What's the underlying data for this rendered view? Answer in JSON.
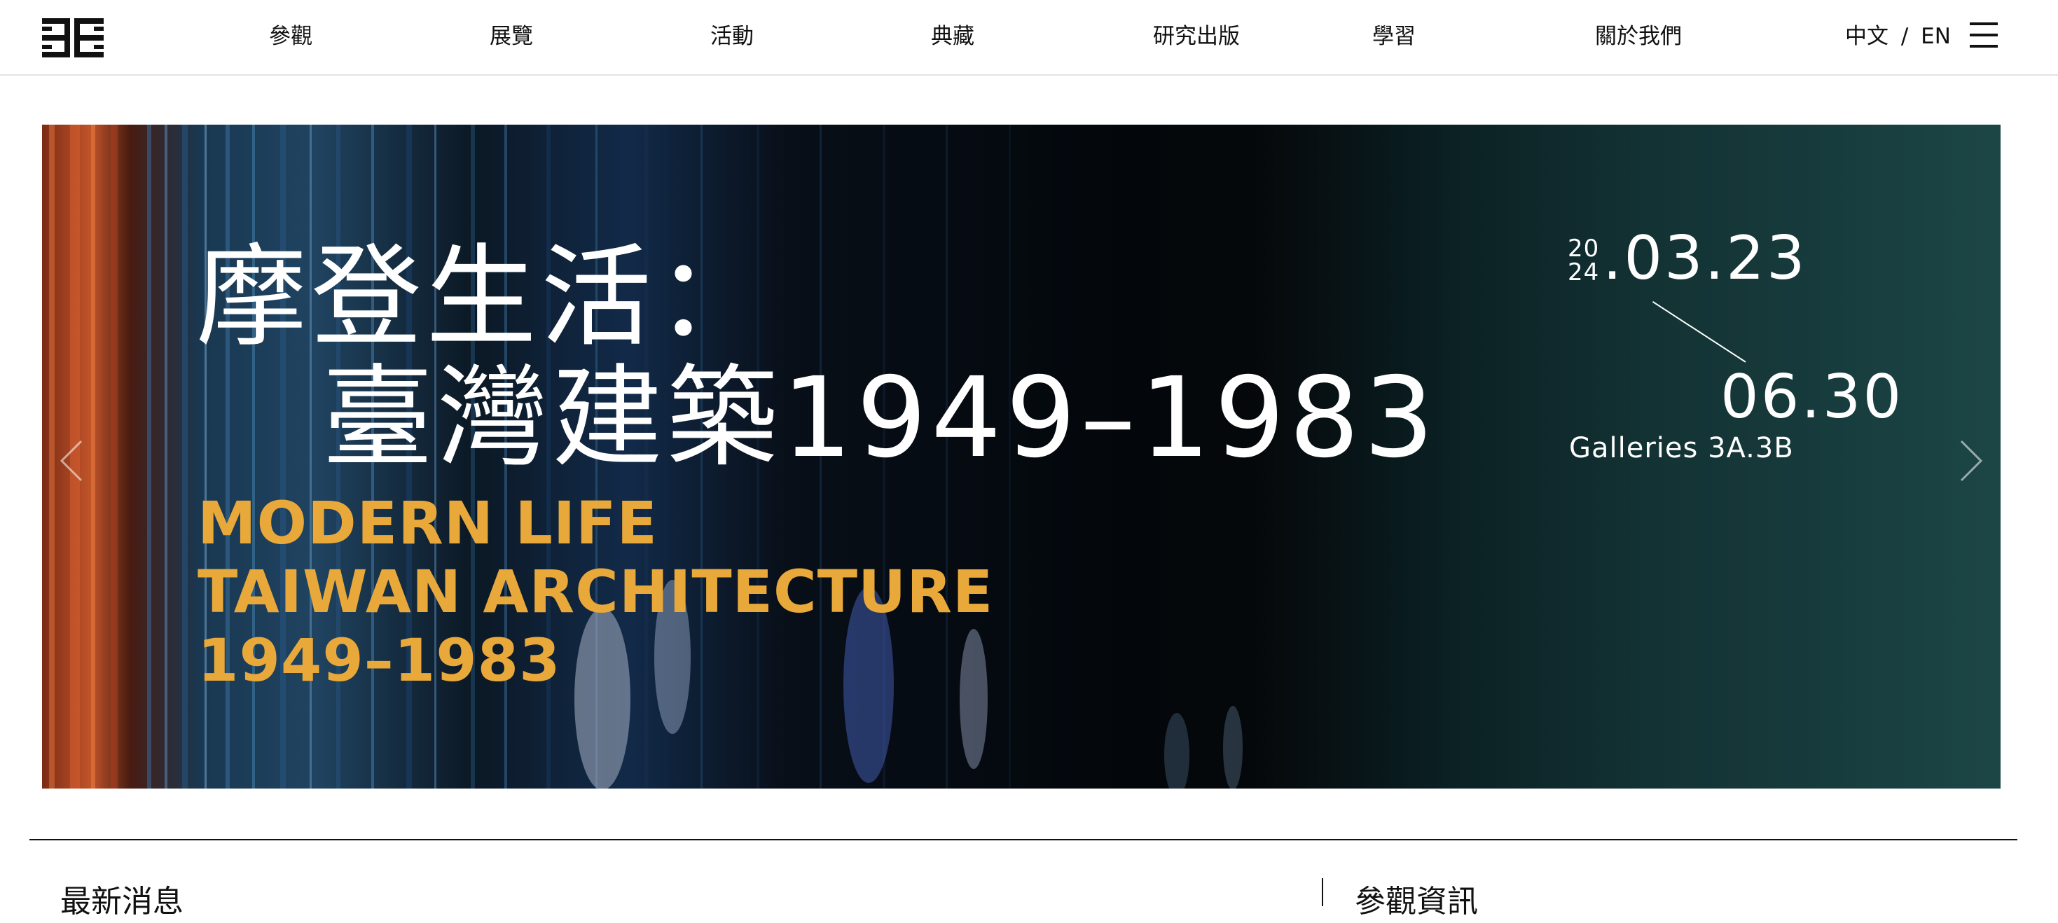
{
  "header": {
    "logo_icon": "museum-logo-icon",
    "nav": [
      {
        "label": "參觀"
      },
      {
        "label": "展覽"
      },
      {
        "label": "活動"
      },
      {
        "label": "典藏"
      },
      {
        "label": "研究出版"
      },
      {
        "label": "學習"
      },
      {
        "label": "關於我們"
      }
    ],
    "lang_zh": "中文",
    "lang_sep": "/",
    "lang_en": "EN",
    "menu_icon": "hamburger-menu-icon"
  },
  "hero": {
    "title_zh_line1": "摩登生活：",
    "title_zh_line2": "臺灣建築1949–1983",
    "title_en_line1": "MODERN LIFE",
    "title_en_line2": "TAIWAN ARCHITECTURE",
    "title_en_line3": "1949–1983",
    "year_top": "20",
    "year_bottom": "24",
    "date_start": ".03.23",
    "date_end": "06.30",
    "venue": "Galleries 3A.3B",
    "prev_icon": "chevron-left-icon",
    "next_icon": "chevron-right-icon",
    "colors": {
      "title_zh": "#ffffff",
      "title_en": "#e9a93a",
      "bg_right": "#1c4646"
    }
  },
  "sections": {
    "news_title": "最新消息",
    "visit_title": "參觀資訊"
  }
}
